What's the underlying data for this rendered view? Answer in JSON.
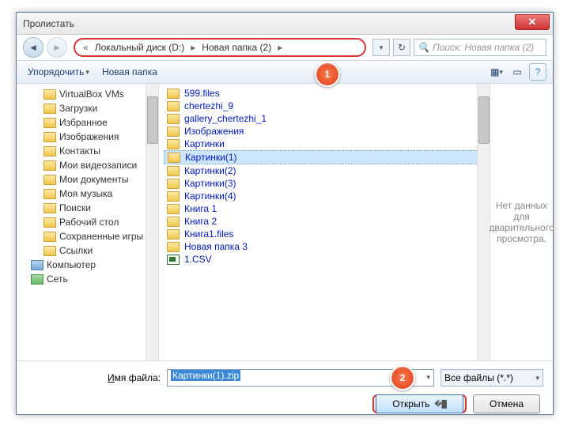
{
  "window": {
    "title": "Пролистать"
  },
  "breadcrumb": {
    "prefix": "«",
    "parts": [
      "Локальный диск (D:)",
      "Новая папка (2)"
    ]
  },
  "search": {
    "placeholder": "Поиск: Новая папка (2)"
  },
  "toolbar": {
    "organize": "Упорядочить",
    "new_folder": "Новая папка"
  },
  "tree": [
    {
      "label": "VirtualBox VMs",
      "icon": "folder"
    },
    {
      "label": "Загрузки",
      "icon": "folder"
    },
    {
      "label": "Избранное",
      "icon": "folder"
    },
    {
      "label": "Изображения",
      "icon": "folder"
    },
    {
      "label": "Контакты",
      "icon": "folder"
    },
    {
      "label": "Мои видеозаписи",
      "icon": "folder"
    },
    {
      "label": "Мои документы",
      "icon": "folder"
    },
    {
      "label": "Моя музыка",
      "icon": "folder"
    },
    {
      "label": "Поиски",
      "icon": "folder"
    },
    {
      "label": "Рабочий стол",
      "icon": "folder"
    },
    {
      "label": "Сохраненные игры",
      "icon": "folder"
    },
    {
      "label": "Ссылки",
      "icon": "folder"
    },
    {
      "label": "Компьютер",
      "icon": "computer",
      "level": 1
    },
    {
      "label": "Сеть",
      "icon": "network",
      "level": 1
    }
  ],
  "files": [
    {
      "name": "599.files",
      "type": "folder"
    },
    {
      "name": "chertezhi_9",
      "type": "folder"
    },
    {
      "name": "gallery_chertezhi_1",
      "type": "folder"
    },
    {
      "name": "Изображения",
      "type": "folder"
    },
    {
      "name": "Картинки",
      "type": "folder"
    },
    {
      "name": "Картинки(1)",
      "type": "folder",
      "selected": true
    },
    {
      "name": "Картинки(2)",
      "type": "folder"
    },
    {
      "name": "Картинки(3)",
      "type": "folder"
    },
    {
      "name": "Картинки(4)",
      "type": "folder"
    },
    {
      "name": "Книга 1",
      "type": "folder"
    },
    {
      "name": "Книга 2",
      "type": "folder"
    },
    {
      "name": "Книга1.files",
      "type": "folder"
    },
    {
      "name": "Новая папка 3",
      "type": "folder"
    },
    {
      "name": "1.CSV",
      "type": "csv"
    }
  ],
  "preview": {
    "text": "Нет данных для дварительного просмотра."
  },
  "filename": {
    "label_pre": "Имя файла:",
    "value": "Картинки(1).zip"
  },
  "filter": {
    "label": "Все файлы (*.*)"
  },
  "buttons": {
    "open": "Открыть",
    "cancel": "Отмена"
  },
  "callouts": {
    "one": "1",
    "two": "2"
  }
}
